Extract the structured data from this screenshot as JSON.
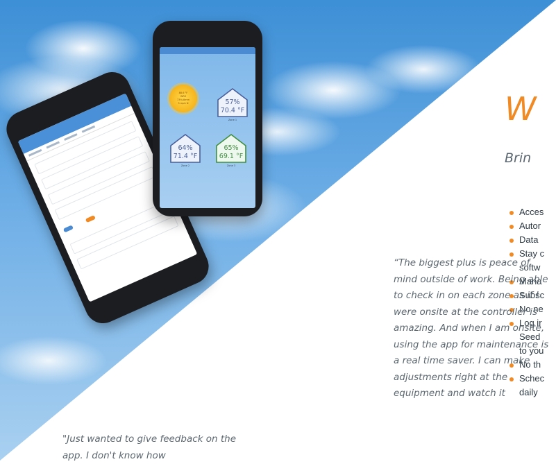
{
  "heading": "W",
  "subheading": "Brin",
  "features": [
    "Acces",
    "Autor",
    "Data",
    "Stay c\nsoftw",
    "Mana",
    "Subsc",
    "No ne",
    "Log ir\nSeed\nto you",
    "No th",
    "Schec\ndaily"
  ],
  "quote_main": "“The biggest plus is peace of mind outside of work. Being able to check in on each zone as if I were onsite at the controller is amazing. And when I am onsite, using the app for maintenance is a real time saver. I can make adjustments right at the equipment and watch it",
  "quote_second": "\"Just wanted to give feedback on the app. I don't know how",
  "weather": {
    "sun_lines": [
      "88.6 °F",
      "WRS",
      "73%/8mm",
      "5 mph N"
    ]
  },
  "zones": [
    {
      "humidity": "57%",
      "temp": "70.4 °F",
      "name": "Zone 1",
      "color": "#4a5f9c"
    },
    {
      "humidity": "64%",
      "temp": "71.4 °F",
      "name": "Zone 2",
      "color": "#4a5f9c"
    },
    {
      "humidity": "65%",
      "temp": "69.1 °F",
      "name": "Zone 3",
      "color": "#3f8f3f"
    }
  ],
  "colors": {
    "accent": "#f08a24",
    "sky": "#4a90d9",
    "text": "#5b6770"
  }
}
